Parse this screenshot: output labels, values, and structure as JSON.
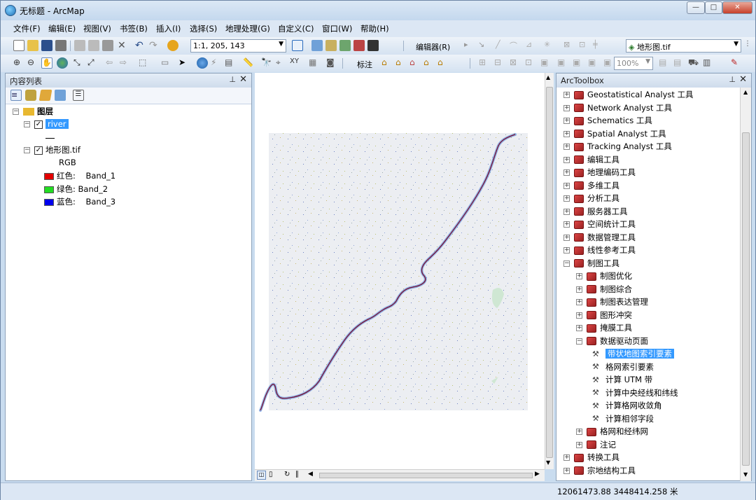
{
  "window": {
    "title": "无标题 - ArcMap",
    "min": "—",
    "max": "□",
    "close": "✕"
  },
  "menu": [
    "文件(F)",
    "编辑(E)",
    "视图(V)",
    "书签(B)",
    "插入(I)",
    "选择(S)",
    "地理处理(G)",
    "自定义(C)",
    "窗口(W)",
    "帮助(H)"
  ],
  "toolbar": {
    "scale": "1:1, 205, 143",
    "editor": "编辑器(R)",
    "layer": "地形图.tif",
    "label": "标注",
    "zoom": "100%"
  },
  "toc": {
    "title": "内容列表",
    "root": "图层",
    "layers": [
      {
        "name": "river",
        "checked": true
      },
      {
        "name": "地形图.tif",
        "checked": true,
        "sub": "RGB",
        "bands": [
          {
            "label": "红色:    Band_1",
            "color": "#e30000"
          },
          {
            "label": "绿色: Band_2",
            "color": "#22dd22"
          },
          {
            "label": "蓝色:    Band_3",
            "color": "#0000ee"
          }
        ]
      }
    ]
  },
  "toolbox": {
    "title": "ArcToolbox",
    "items": [
      {
        "label": "Geostatistical Analyst 工具",
        "level": 0,
        "exp": "+"
      },
      {
        "label": "Network Analyst 工具",
        "level": 0,
        "exp": "+"
      },
      {
        "label": "Schematics 工具",
        "level": 0,
        "exp": "+"
      },
      {
        "label": "Spatial Analyst 工具",
        "level": 0,
        "exp": "+"
      },
      {
        "label": "Tracking Analyst 工具",
        "level": 0,
        "exp": "+"
      },
      {
        "label": "编辑工具",
        "level": 0,
        "exp": "+"
      },
      {
        "label": "地理编码工具",
        "level": 0,
        "exp": "+"
      },
      {
        "label": "多维工具",
        "level": 0,
        "exp": "+"
      },
      {
        "label": "分析工具",
        "level": 0,
        "exp": "+"
      },
      {
        "label": "服务器工具",
        "level": 0,
        "exp": "+"
      },
      {
        "label": "空间统计工具",
        "level": 0,
        "exp": "+"
      },
      {
        "label": "数据管理工具",
        "level": 0,
        "exp": "+"
      },
      {
        "label": "线性参考工具",
        "level": 0,
        "exp": "+"
      },
      {
        "label": "制图工具",
        "level": 0,
        "exp": "−"
      },
      {
        "label": "制图优化",
        "level": 1,
        "exp": "+"
      },
      {
        "label": "制图综合",
        "level": 1,
        "exp": "+"
      },
      {
        "label": "制图表达管理",
        "level": 1,
        "exp": "+"
      },
      {
        "label": "图形冲突",
        "level": 1,
        "exp": "+"
      },
      {
        "label": "掩膜工具",
        "level": 1,
        "exp": "+"
      },
      {
        "label": "数据驱动页面",
        "level": 1,
        "exp": "−"
      },
      {
        "label": "带状地图索引要素",
        "level": 2,
        "exp": "",
        "selected": true
      },
      {
        "label": "格网索引要素",
        "level": 2,
        "exp": ""
      },
      {
        "label": "计算 UTM 带",
        "level": 2,
        "exp": ""
      },
      {
        "label": "计算中央经线和纬线",
        "level": 2,
        "exp": ""
      },
      {
        "label": "计算格网收敛角",
        "level": 2,
        "exp": ""
      },
      {
        "label": "计算相邻字段",
        "level": 2,
        "exp": ""
      },
      {
        "label": "格网和经纬网",
        "level": 1,
        "exp": "+"
      },
      {
        "label": "注记",
        "level": 1,
        "exp": "+"
      },
      {
        "label": "转换工具",
        "level": 0,
        "exp": "+"
      },
      {
        "label": "宗地结构工具",
        "level": 0,
        "exp": "+"
      }
    ]
  },
  "status": {
    "coords": "12061473.88  3448414.258 米"
  }
}
